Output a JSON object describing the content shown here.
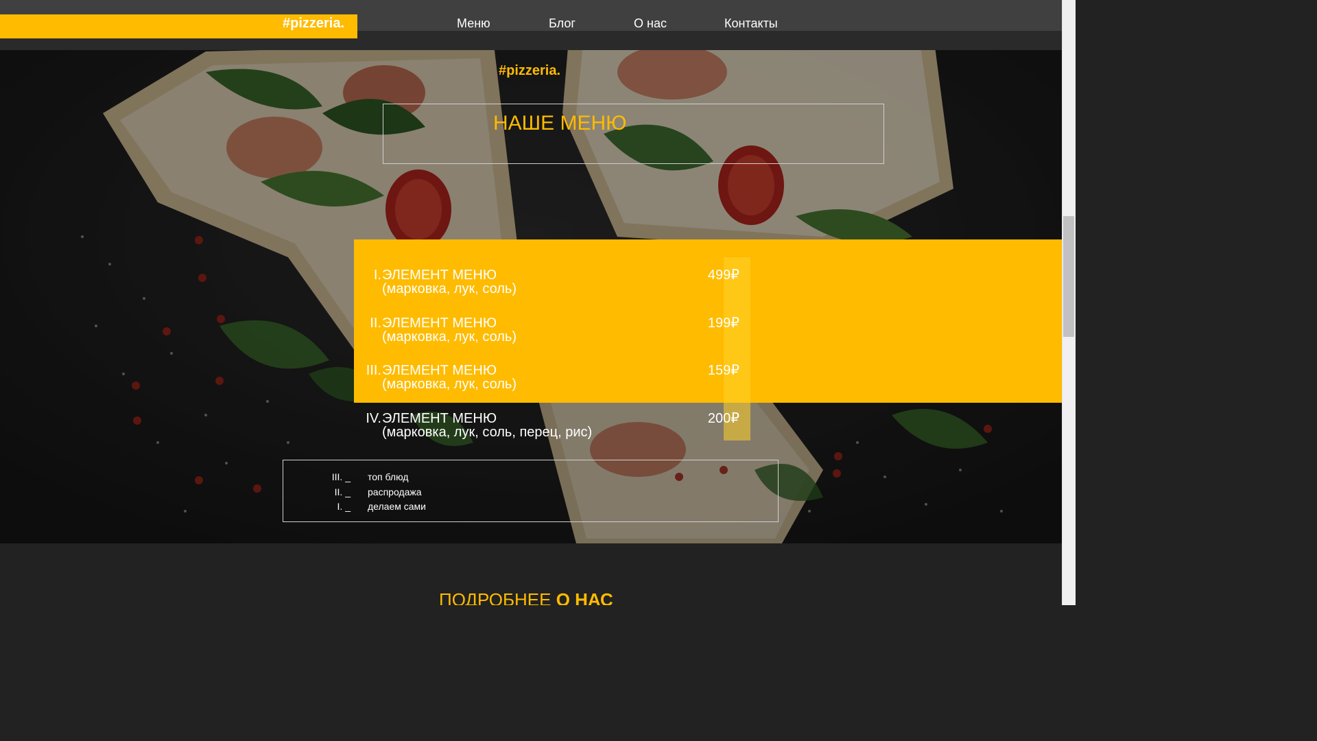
{
  "header": {
    "logo": "#pizzeria.",
    "nav": [
      {
        "label": "Меню"
      },
      {
        "label": "Блог"
      },
      {
        "label": "О нас"
      },
      {
        "label": "Контакты"
      }
    ]
  },
  "hero": {
    "logo": "#pizzeria.",
    "title": "НАШЕ МЕНЮ"
  },
  "menu": {
    "items": [
      {
        "num": "I.",
        "name": "ЭЛЕМЕНТ МЕНЮ",
        "desc": "(марковка, лук, соль)",
        "price": "499₽"
      },
      {
        "num": "II.",
        "name": "ЭЛЕМЕНТ МЕНЮ",
        "desc": "(марковка, лук, соль)",
        "price": "199₽"
      },
      {
        "num": "III.",
        "name": "ЭЛЕМЕНТ МЕНЮ",
        "desc": "(марковка, лук, соль)",
        "price": "159₽"
      },
      {
        "num": "IV.",
        "name": "ЭЛЕМЕНТ МЕНЮ",
        "desc": "(марковка, лук, соль, перец, рис)",
        "price": "200₽"
      }
    ]
  },
  "tags": [
    {
      "num": "III. _",
      "label": "топ блюд"
    },
    {
      "num": "II. _",
      "label": "распродажа"
    },
    {
      "num": "I. _",
      "label": "делаем сами"
    }
  ],
  "about": {
    "title_light": "ПОДРОБНЕЕ",
    "title_bold": "О НАС"
  },
  "colors": {
    "accent": "#ffbb00",
    "navbar": "#404040",
    "background": "#222222"
  }
}
